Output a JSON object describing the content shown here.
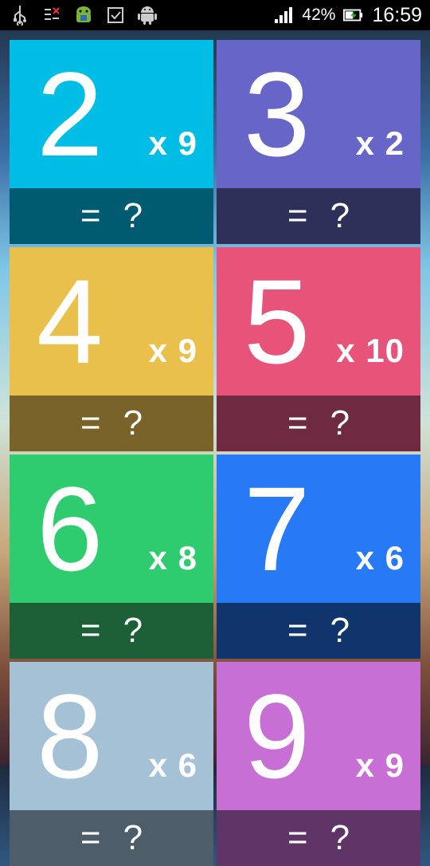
{
  "statusbar": {
    "battery": "42%",
    "time": "16:59",
    "icons": [
      "usb-icon",
      "debug-icon",
      "android-robot-icon",
      "checkbox-icon",
      "android-icon",
      "signal-icon",
      "battery-charging-icon"
    ]
  },
  "cards": [
    {
      "base": "2",
      "multiplier": "x 9",
      "eq": "=",
      "answer": "?",
      "top_color": "#00bde6",
      "bottom_color": "#005a70"
    },
    {
      "base": "3",
      "multiplier": "x 2",
      "eq": "=",
      "answer": "?",
      "top_color": "#6766c8",
      "bottom_color": "#2f305a"
    },
    {
      "base": "4",
      "multiplier": "x 9",
      "eq": "=",
      "answer": "?",
      "top_color": "#eac04d",
      "bottom_color": "#7a6328"
    },
    {
      "base": "5",
      "multiplier": "x 10",
      "eq": "=",
      "answer": "?",
      "top_color": "#e75379",
      "bottom_color": "#6e2a40"
    },
    {
      "base": "6",
      "multiplier": "x 8",
      "eq": "=",
      "answer": "?",
      "top_color": "#2ecc6f",
      "bottom_color": "#1d5f37"
    },
    {
      "base": "7",
      "multiplier": "x 6",
      "eq": "=",
      "answer": "?",
      "top_color": "#2779f5",
      "bottom_color": "#10346c"
    },
    {
      "base": "8",
      "multiplier": "x 6",
      "eq": "=",
      "answer": "?",
      "top_color": "#a4c1d6",
      "bottom_color": "#4d5d69"
    },
    {
      "base": "9",
      "multiplier": "x 9",
      "eq": "=",
      "answer": "?",
      "top_color": "#c86fd6",
      "bottom_color": "#5f3467"
    }
  ]
}
